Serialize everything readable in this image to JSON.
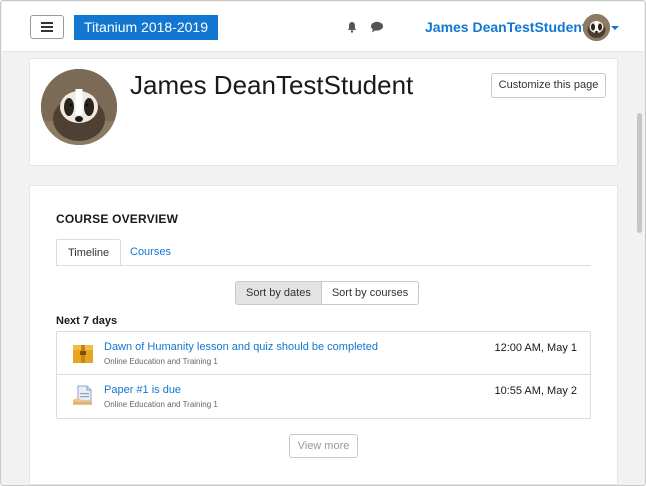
{
  "navbar": {
    "site_title": "Titanium 2018-2019",
    "user_name": "James DeanTestStudent",
    "icons": [
      "menu-icon",
      "bell-icon",
      "chat-icon",
      "chevron-down-icon"
    ]
  },
  "header": {
    "full_name": "James DeanTestStudent",
    "customize_label": "Customize this page"
  },
  "course_overview": {
    "title": "COURSE OVERVIEW",
    "tabs": [
      {
        "label": "Timeline",
        "active": true
      },
      {
        "label": "Courses",
        "active": false
      }
    ],
    "sort_options": [
      {
        "label": "Sort by dates",
        "active": true
      },
      {
        "label": "Sort by courses",
        "active": false
      }
    ],
    "section_label": "Next 7 days",
    "events": [
      {
        "icon": "lesson-icon",
        "title": "Dawn of Humanity lesson and quiz should be completed",
        "course": "Online Education and Training 1",
        "time": "12:00 AM, May 1"
      },
      {
        "icon": "assignment-icon",
        "title": "Paper #1 is due",
        "course": "Online Education and Training 1",
        "time": "10:55 AM, May 2"
      }
    ],
    "view_more_label": "View more"
  },
  "colors": {
    "accent": "#1177d1",
    "page_bg": "#f2f2f2",
    "card_bg": "#ffffff"
  }
}
